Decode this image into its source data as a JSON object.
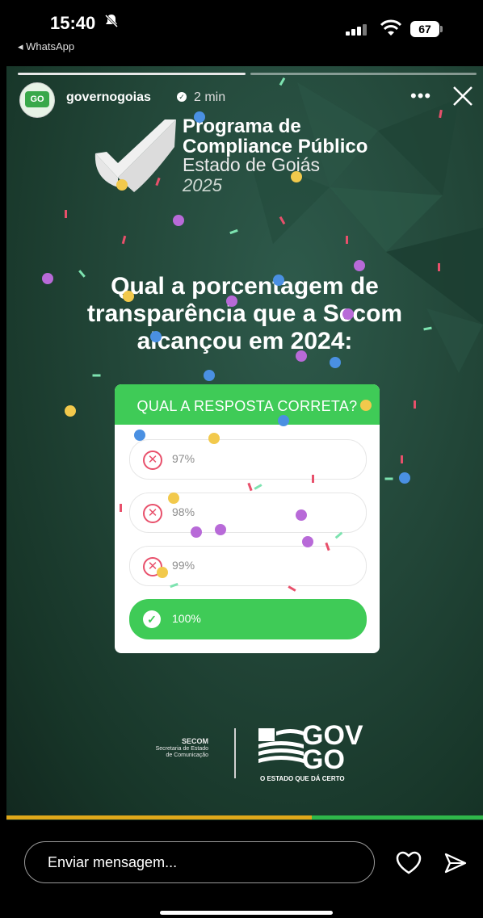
{
  "status_bar": {
    "time": "15:40",
    "back_app": "◂ WhatsApp",
    "battery": "67",
    "bell_icon": "bell-slash-icon"
  },
  "story": {
    "username": "governogoias",
    "time_ago": "2 min",
    "more_label": "•••",
    "avatar_text": "GO",
    "program": {
      "line1": "Programa de",
      "line2": "Compliance Público",
      "line3": "Estado de Goiás",
      "year": "2025"
    },
    "question": "Qual a porcentagem de transparência que a Secom alcançou em 2024:",
    "quiz": {
      "header": "QUAL A RESPOSTA CORRETA?",
      "options": [
        {
          "label": "97%",
          "correct": false
        },
        {
          "label": "98%",
          "correct": false
        },
        {
          "label": "99%",
          "correct": false
        },
        {
          "label": "100%",
          "correct": true
        }
      ]
    },
    "footer": {
      "secom_title": "SECOM",
      "secom_line1": "Secretaria de Estado",
      "secom_line2": "de Comunicação",
      "govgo_top": "GOV",
      "govgo_bottom": "GO",
      "govgo_tagline": "O ESTADO QUE DÁ CERTO"
    }
  },
  "reply": {
    "placeholder": "Enviar mensagem..."
  },
  "colors": {
    "quiz_green": "#3fcb57",
    "wrong_red": "#e8506b",
    "story_bg": "#224638",
    "progress_yellow": "#e0a81a"
  }
}
